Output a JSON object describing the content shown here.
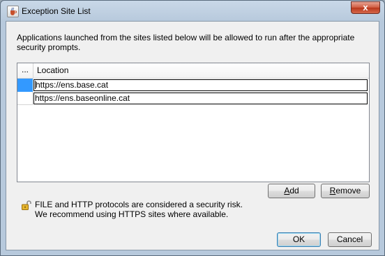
{
  "window": {
    "title": "Exception Site List",
    "close_symbol": "x",
    "app_icon": "java-cup-icon"
  },
  "description": "Applications launched from the sites listed below will be allowed to run after the appropriate security prompts.",
  "table": {
    "columns": [
      "...",
      "Location"
    ],
    "rows": [
      {
        "location": "https://ens.base.cat",
        "selected": true,
        "editing": true
      },
      {
        "location": "https://ens.baseonline.cat",
        "selected": false,
        "editing": false
      }
    ]
  },
  "buttons": {
    "add": "Add",
    "add_mnemonic": "A",
    "remove": "Remove",
    "remove_mnemonic": "R",
    "ok": "OK",
    "cancel": "Cancel"
  },
  "warning": {
    "icon": "open-lock-icon",
    "line1": "FILE and HTTP protocols are considered a security risk.",
    "line2": "We recommend using HTTPS sites where available."
  },
  "colors": {
    "selection": "#3399ff",
    "close_button": "#c94a2f"
  }
}
